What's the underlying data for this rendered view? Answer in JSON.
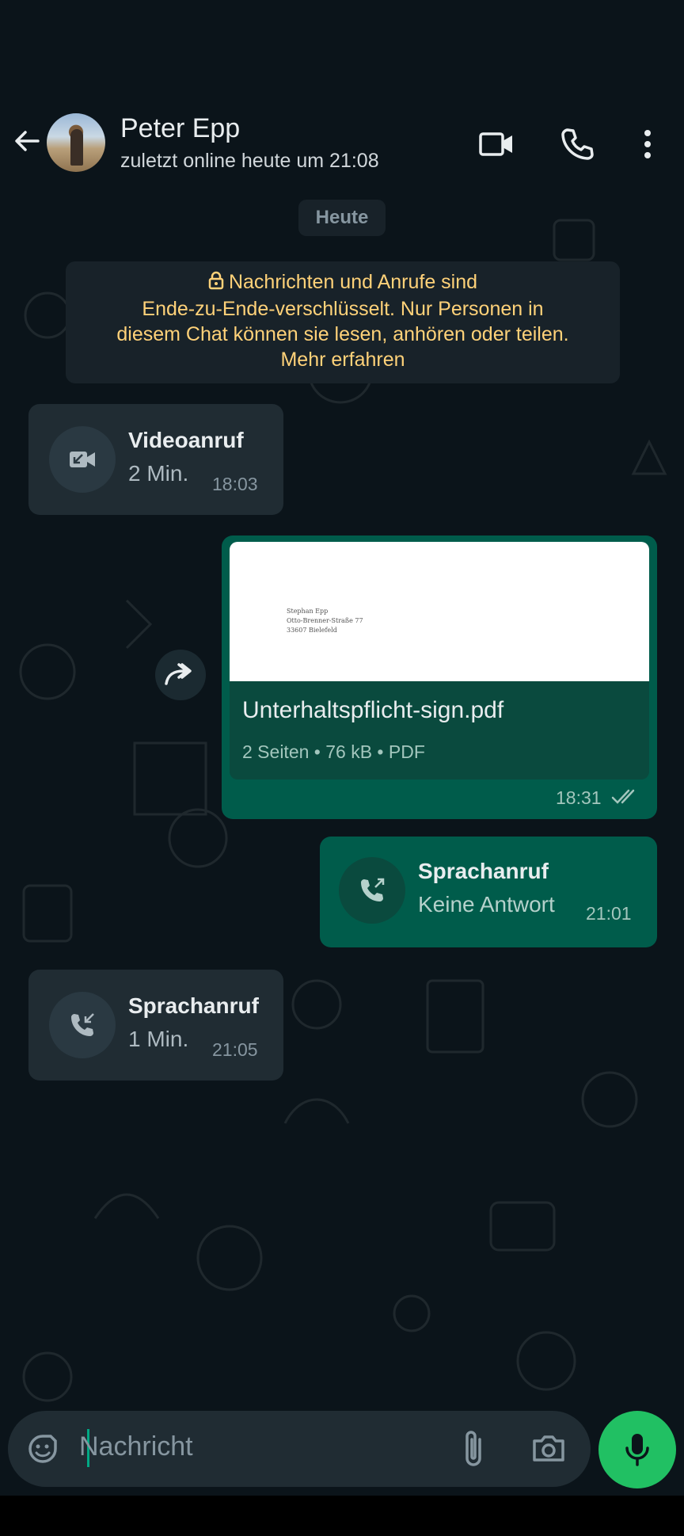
{
  "header": {
    "contact_name": "Peter Epp",
    "status": "zuletzt online heute um 21:08",
    "icons": [
      "back-arrow-icon",
      "video-call-icon",
      "phone-icon",
      "more-options-icon"
    ]
  },
  "chat": {
    "date_chip": "Heute",
    "e2e_notice": {
      "line1": "Nachrichten und Anrufe sind",
      "line2": "Ende-zu-Ende-verschlüsselt. Nur Personen in",
      "line3": "diesem Chat können sie lesen, anhören oder teilen.",
      "line4": "Mehr erfahren"
    },
    "messages": [
      {
        "type": "call",
        "direction": "incoming",
        "title": "Videoanruf",
        "subtitle": "2 Min.",
        "time": "18:03",
        "icon": "missed-video-call-icon"
      },
      {
        "type": "document",
        "direction": "outgoing",
        "filename": "Unterhaltspflicht-sign.pdf",
        "meta": "2 Seiten • 76 kB • PDF",
        "time": "18:31",
        "preview_lines": "Stephan Epp\nOtto-Brenner-Straße 77\n33607 Bielefeld",
        "status_icon": "double-check-icon"
      },
      {
        "type": "call",
        "direction": "outgoing",
        "title": "Sprachanruf",
        "subtitle": "Keine Antwort",
        "time": "21:01",
        "icon": "outgoing-call-icon"
      },
      {
        "type": "call",
        "direction": "incoming",
        "title": "Sprachanruf",
        "subtitle": "1 Min.",
        "time": "21:05",
        "icon": "incoming-call-icon"
      }
    ]
  },
  "input": {
    "placeholder": "Nachricht"
  },
  "colors": {
    "background": "#0b141a",
    "incoming_bubble": "#202c33",
    "outgoing_bubble": "#005c4b",
    "accent_green": "#21c063",
    "notice_text": "#ffd279"
  }
}
